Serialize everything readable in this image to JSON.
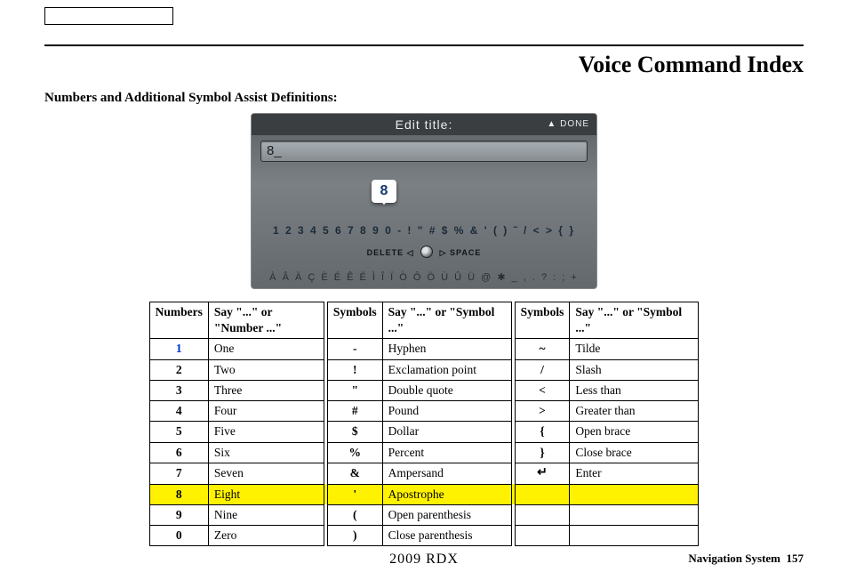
{
  "header": {
    "title": "Voice Command Index",
    "subtitle": "Numbers and Additional Symbol Assist Definitions:"
  },
  "screenshot": {
    "title": "Edit title:",
    "done": "▲ DONE",
    "input_value": "8_",
    "bubble": "8",
    "char_row": "1 2 3 4 5 6 7 8 9 0 - ! \" # $ % & ' ( ) ˜ / < > { }",
    "delete_label": "DELETE ◁",
    "space_label": "▷ SPACE",
    "alt_row": "À Â Ä Ç È É Ê Ë Ì Î Ï Ò Ô Ö Ù Û Ü @ ✱ _  , . ? : ; +"
  },
  "table": {
    "headers": {
      "numbers": "Numbers",
      "say_number": "Say \"...\" or \"Number ...\"",
      "symbols": "Symbols",
      "say_symbol": "Say \"...\" or \"Symbol ...\""
    },
    "numbers": [
      {
        "n": "1",
        "say": "One",
        "cls": "num1"
      },
      {
        "n": "2",
        "say": "Two"
      },
      {
        "n": "3",
        "say": "Three"
      },
      {
        "n": "4",
        "say": "Four"
      },
      {
        "n": "5",
        "say": "Five"
      },
      {
        "n": "6",
        "say": "Six"
      },
      {
        "n": "7",
        "say": "Seven"
      },
      {
        "n": "8",
        "say": "Eight",
        "hl": true
      },
      {
        "n": "9",
        "say": "Nine"
      },
      {
        "n": "0",
        "say": "Zero"
      }
    ],
    "symbols1": [
      {
        "s": "-",
        "say": "Hyphen"
      },
      {
        "s": "!",
        "say": "Exclamation point"
      },
      {
        "s": "\"",
        "say": "Double quote"
      },
      {
        "s": "#",
        "say": "Pound"
      },
      {
        "s": "$",
        "say": "Dollar"
      },
      {
        "s": "%",
        "say": "Percent"
      },
      {
        "s": "&",
        "say": "Ampersand"
      },
      {
        "s": "'",
        "say": "Apostrophe"
      },
      {
        "s": "(",
        "say": "Open parenthesis"
      },
      {
        "s": ")",
        "say": "Close parenthesis"
      }
    ],
    "symbols2": [
      {
        "s": "~",
        "say": "Tilde"
      },
      {
        "s": "/",
        "say": "Slash"
      },
      {
        "s": "<",
        "say": "Less than"
      },
      {
        "s": ">",
        "say": "Greater than"
      },
      {
        "s": "{",
        "say": "Open brace"
      },
      {
        "s": "}",
        "say": "Close brace"
      },
      {
        "s": "↵",
        "say": "Enter",
        "glyph": true
      }
    ]
  },
  "footer": {
    "center": "2009  RDX",
    "right_label": "Navigation System",
    "page": "157"
  }
}
